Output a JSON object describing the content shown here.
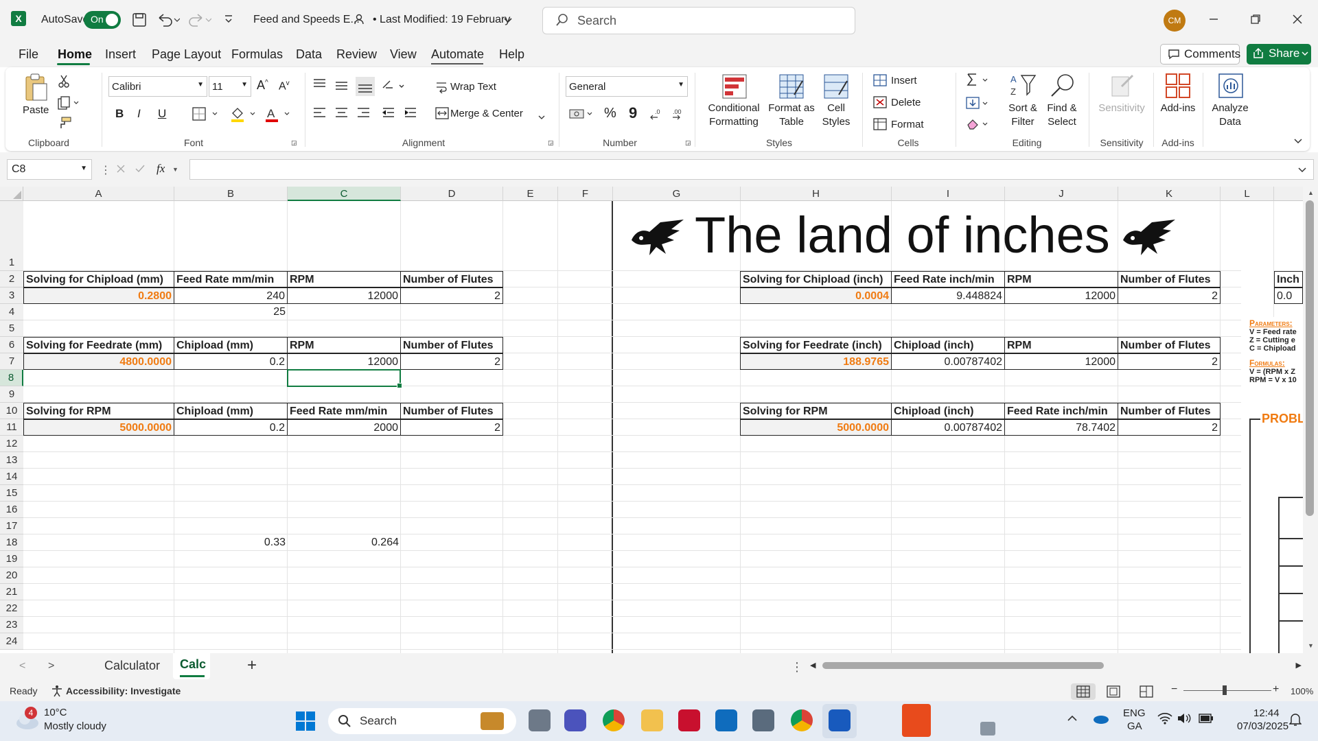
{
  "titlebar": {
    "autosave_label": "AutoSave",
    "autosave_state": "On",
    "file_name": "Feed and Speeds E...",
    "modified": "• Last Modified: 19 February",
    "search_placeholder": "Search",
    "user_initials": "CM"
  },
  "menu": {
    "items": [
      "File",
      "Home",
      "Insert",
      "Page Layout",
      "Formulas",
      "Data",
      "Review",
      "View",
      "Automate",
      "Help"
    ],
    "active": "Home",
    "comments_label": "Comments",
    "share_label": "Share"
  },
  "ribbon": {
    "clipboard": {
      "paste": "Paste",
      "label": "Clipboard"
    },
    "font": {
      "family": "Calibri",
      "size": "11",
      "label": "Font",
      "bold": "B",
      "italic": "I",
      "underline": "U"
    },
    "alignment": {
      "wrap_text": "Wrap Text",
      "merge_center": "Merge & Center",
      "label": "Alignment"
    },
    "number": {
      "format": "General",
      "label": "Number",
      "percent": "%",
      "comma": "9"
    },
    "styles": {
      "conditional": [
        "Conditional",
        "Formatting"
      ],
      "format_table": [
        "Format as",
        "Table"
      ],
      "cell_styles": [
        "Cell",
        "Styles"
      ],
      "label": "Styles"
    },
    "cells": {
      "insert": "Insert",
      "delete": "Delete",
      "format": "Format",
      "label": "Cells"
    },
    "editing": {
      "sort_filter": [
        "Sort &",
        "Filter"
      ],
      "find_select": [
        "Find &",
        "Select"
      ],
      "label": "Editing"
    },
    "sensitivity": {
      "button": "Sensitivity",
      "label": "Sensitivity"
    },
    "addins": {
      "button": "Add-ins",
      "label": "Add-ins"
    },
    "analyze": {
      "button": [
        "Analyze",
        "Data"
      ]
    }
  },
  "formula_bar": {
    "name_box": "C8",
    "fx": "fx",
    "content": ""
  },
  "columns": [
    "A",
    "B",
    "C",
    "D",
    "E",
    "F",
    "G",
    "H",
    "I",
    "J",
    "K",
    "L"
  ],
  "selected_column": "C",
  "rows": [
    "1",
    "2",
    "3",
    "4",
    "5",
    "6",
    "7",
    "8",
    "9",
    "10",
    "11",
    "12",
    "13",
    "14",
    "15",
    "16",
    "17",
    "18",
    "19",
    "20",
    "21",
    "22",
    "23",
    "24"
  ],
  "sheet": {
    "banner": "The land of inches",
    "mm": {
      "chipload": {
        "headers": [
          "Solving for Chipload (mm)",
          "Feed Rate mm/min",
          "RPM",
          "Number of Flutes"
        ],
        "values": [
          "0.2800",
          "240",
          "12000",
          "2"
        ],
        "extra_b4": "25"
      },
      "feedrate": {
        "headers": [
          "Solving for Feedrate (mm)",
          "Chipload (mm)",
          "RPM",
          "Number of Flutes"
        ],
        "values": [
          "4800.0000",
          "0.2",
          "12000",
          "2"
        ]
      },
      "rpm": {
        "headers": [
          "Solving for RPM",
          "Chipload (mm)",
          "Feed Rate mm/min",
          "Number of Flutes"
        ],
        "values": [
          "5000.0000",
          "0.2",
          "2000",
          "2"
        ]
      },
      "row18": [
        "0.33",
        "0.264"
      ]
    },
    "inch": {
      "chipload": {
        "headers": [
          "Solving for Chipload (inch)",
          "Feed Rate inch/min",
          "RPM",
          "Number of Flutes"
        ],
        "values": [
          "0.0004",
          "9.448824",
          "12000",
          "2"
        ]
      },
      "feedrate": {
        "headers": [
          "Solving for Feedrate (inch)",
          "Chipload (inch)",
          "RPM",
          "Number of Flutes"
        ],
        "values": [
          "188.9765",
          "0.00787402",
          "12000",
          "2"
        ]
      },
      "rpm": {
        "headers": [
          "Solving for RPM",
          "Chipload (inch)",
          "Feed Rate inch/min",
          "Number of Flutes"
        ],
        "values": [
          "5000.0000",
          "0.00787402",
          "78.7402",
          "2"
        ]
      }
    },
    "col_l": {
      "header": "Inch",
      "value": "0.0"
    },
    "side_notes": {
      "parameters": "Parameters:",
      "lines": [
        "V = Feed rate",
        "Z = Cutting e",
        "C = Chipload"
      ],
      "formulas": "Formulas:",
      "formula_lines": [
        "V = (RPM x Z",
        "RPM = V x 10"
      ],
      "problem": "PROBL"
    }
  },
  "tabs": {
    "sheets": [
      "Calculator",
      "Calc"
    ],
    "active": "Calc",
    "add": "+"
  },
  "status": {
    "ready": "Ready",
    "accessibility": "Accessibility: Investigate",
    "zoom": "100%"
  },
  "taskbar": {
    "weather_temp": "10°C",
    "weather_desc": "Mostly cloudy",
    "weather_badge": "4",
    "search": "Search",
    "lang1": "ENG",
    "lang2": "GA",
    "time": "12:44",
    "date": "07/03/2025"
  },
  "colors": {
    "excel_green": "#107c41",
    "orange": "#f07b12"
  }
}
